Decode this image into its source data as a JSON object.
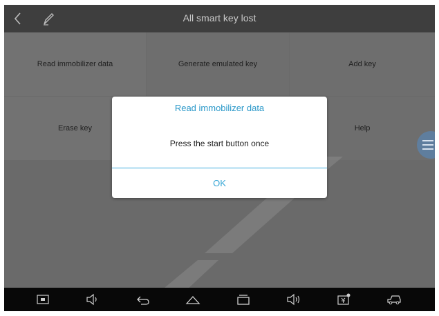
{
  "header": {
    "title": "All smart key lost"
  },
  "menu": {
    "items": [
      {
        "label": "Read immobilizer data"
      },
      {
        "label": "Generate emulated key"
      },
      {
        "label": "Add key"
      },
      {
        "label": "Erase key"
      },
      {
        "label": ""
      },
      {
        "label": "Help"
      }
    ]
  },
  "dialog": {
    "title": "Read immobilizer data",
    "message": "Press the start button once",
    "ok_label": "OK"
  },
  "icons": {
    "back": "chevron-left-icon",
    "edit": "pencil-icon",
    "side_menu": "hamburger-menu-icon",
    "nav": [
      "screenshot-icon",
      "volume-down-icon",
      "back-arrow-icon",
      "home-icon",
      "recent-apps-icon",
      "volume-up-icon",
      "vci-icon",
      "car-icon"
    ]
  },
  "colors": {
    "titlebar": "#3e3e3e",
    "accent": "#2a98c9",
    "navbar": "#080808"
  }
}
